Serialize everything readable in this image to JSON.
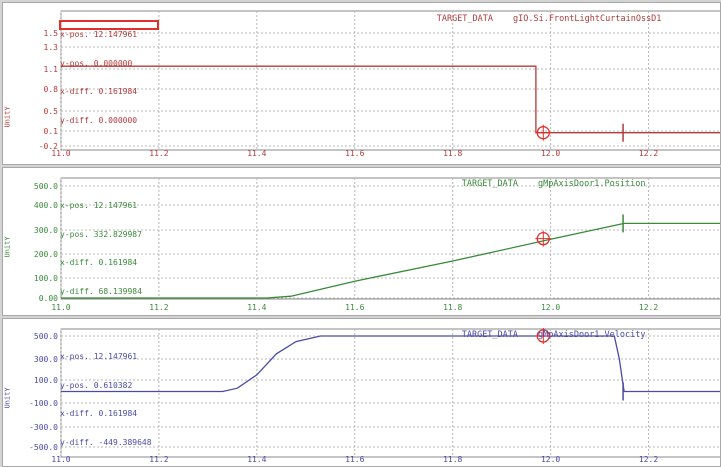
{
  "colors": {
    "red": "#b23a3a",
    "green": "#3a8a3a",
    "blue": "#4a4aa8",
    "grid": "#b8b8b8",
    "marker": "#e0302c",
    "highlight": "#e0302c"
  },
  "x_axis": {
    "min": 11.0,
    "max": 12.35,
    "ticks": [
      "11.0",
      "11.2",
      "11.4",
      "11.6",
      "11.8",
      "12.0",
      "12.2"
    ],
    "tick_values": [
      11.0,
      11.2,
      11.4,
      11.6,
      11.8,
      12.0,
      12.2
    ]
  },
  "panels": [
    {
      "title_label": "TARGET_DATA",
      "variable": "gIO.Si.FrontLightCurtainOssD1",
      "y_axis_label": "UnitY",
      "y_ticks": [
        "1.5",
        "1.3",
        "1.1",
        "0.8",
        "0.5",
        "0.1",
        "-0.2"
      ],
      "cursor_readout": [
        {
          "label": "x-pos.",
          "value": "12.147961"
        },
        {
          "label": "y-pos.",
          "value": "0.000000"
        },
        {
          "label": "x-diff.",
          "value": "0.161984"
        },
        {
          "label": "y-diff.",
          "value": "0.000000"
        }
      ],
      "highlighted_row": "x-diff.",
      "signal": [
        [
          11.0,
          1.0
        ],
        [
          11.97,
          1.0
        ],
        [
          11.97,
          0.0
        ],
        [
          12.35,
          0.0
        ]
      ],
      "cursor1": {
        "x": 11.985,
        "y": 0.0
      },
      "cursor2": {
        "x": 12.147961,
        "y": 0.0
      }
    },
    {
      "title_label": "TARGET_DATA",
      "variable": "gMpAxisDoor1.Position",
      "y_axis_label": "UnitY",
      "y_ticks": [
        "500.0",
        "400.0",
        "300.0",
        "200.0",
        "100.0",
        "0.00"
      ],
      "cursor_readout": [
        {
          "label": "x-pos.",
          "value": "12.147961"
        },
        {
          "label": "y-pos.",
          "value": "332.829987"
        },
        {
          "label": "x-diff.",
          "value": "0.161984"
        },
        {
          "label": "y-diff.",
          "value": "68.139984"
        }
      ],
      "signal": [
        [
          11.0,
          0
        ],
        [
          11.42,
          0
        ],
        [
          11.47,
          8
        ],
        [
          11.6,
          75
        ],
        [
          11.8,
          165
        ],
        [
          12.0,
          262
        ],
        [
          12.15,
          333
        ],
        [
          12.35,
          333
        ]
      ],
      "cursor1": {
        "x": 11.985,
        "y": 265
      },
      "cursor2": {
        "x": 12.147961,
        "y": 333
      }
    },
    {
      "title_label": "TARGET_DATA",
      "variable": "gMpAxisDoor1.Velocity",
      "y_axis_label": "UnitY",
      "y_ticks": [
        "500.0",
        "300.0",
        "100.0",
        "-100.0",
        "-300.0",
        "-500.0"
      ],
      "cursor_readout": [
        {
          "label": "x-pos.",
          "value": "12.147961"
        },
        {
          "label": "y-pos.",
          "value": "0.610382"
        },
        {
          "label": "x-diff.",
          "value": "0.161984"
        },
        {
          "label": "y-diff.",
          "value": "-449.389648"
        }
      ],
      "signal": [
        [
          11.0,
          0
        ],
        [
          11.33,
          0
        ],
        [
          11.36,
          30
        ],
        [
          11.4,
          150
        ],
        [
          11.44,
          340
        ],
        [
          11.48,
          450
        ],
        [
          11.53,
          500
        ],
        [
          12.13,
          500
        ],
        [
          12.14,
          300
        ],
        [
          12.15,
          0
        ],
        [
          12.35,
          0
        ]
      ],
      "cursor1": {
        "x": 11.985,
        "y": 500
      },
      "cursor2": {
        "x": 12.147961,
        "y": 0
      }
    }
  ]
}
